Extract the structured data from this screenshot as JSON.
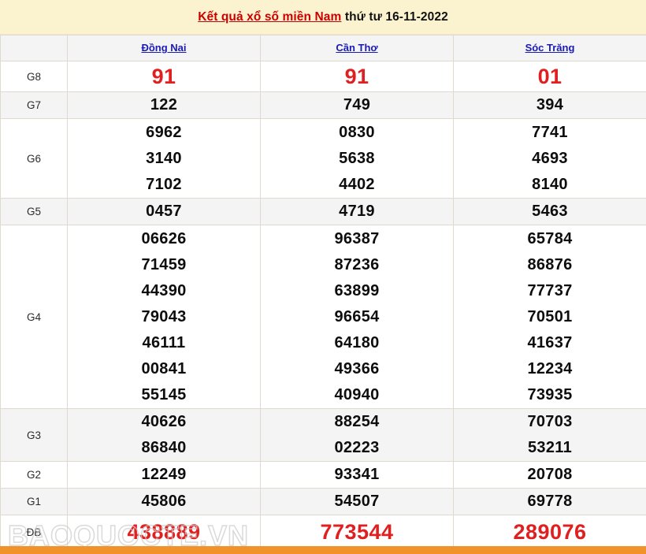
{
  "header": {
    "title_highlight": "Kết quả xổ số miền Nam",
    "title_rest": " thứ tư 16-11-2022"
  },
  "table": {
    "corner_label": "",
    "columns": [
      "Đồng Nai",
      "Cần Thơ",
      "Sóc Trăng"
    ],
    "rows": [
      {
        "label": "G8",
        "style": "special",
        "cells": [
          [
            "91"
          ],
          [
            "91"
          ],
          [
            "01"
          ]
        ]
      },
      {
        "label": "G7",
        "style": "normal",
        "cells": [
          [
            "122"
          ],
          [
            "749"
          ],
          [
            "394"
          ]
        ]
      },
      {
        "label": "G6",
        "style": "normal",
        "cells": [
          [
            "6962",
            "3140",
            "7102"
          ],
          [
            "0830",
            "5638",
            "4402"
          ],
          [
            "7741",
            "4693",
            "8140"
          ]
        ]
      },
      {
        "label": "G5",
        "style": "normal",
        "cells": [
          [
            "0457"
          ],
          [
            "4719"
          ],
          [
            "5463"
          ]
        ]
      },
      {
        "label": "G4",
        "style": "normal",
        "cells": [
          [
            "06626",
            "71459",
            "44390",
            "79043",
            "46111",
            "00841",
            "55145"
          ],
          [
            "96387",
            "87236",
            "63899",
            "96654",
            "64180",
            "49366",
            "40940"
          ],
          [
            "65784",
            "86876",
            "77737",
            "70501",
            "41637",
            "12234",
            "73935"
          ]
        ]
      },
      {
        "label": "G3",
        "style": "normal",
        "cells": [
          [
            "40626",
            "86840"
          ],
          [
            "88254",
            "02223"
          ],
          [
            "70703",
            "53211"
          ]
        ]
      },
      {
        "label": "G2",
        "style": "normal",
        "cells": [
          [
            "12249"
          ],
          [
            "93341"
          ],
          [
            "20708"
          ]
        ]
      },
      {
        "label": "G1",
        "style": "normal",
        "cells": [
          [
            "45806"
          ],
          [
            "54507"
          ],
          [
            "69778"
          ]
        ]
      },
      {
        "label": "ĐB",
        "style": "db",
        "cells": [
          [
            "438889"
          ],
          [
            "773544"
          ],
          [
            "289076"
          ]
        ]
      }
    ]
  },
  "watermark": {
    "text": "BAOQUOCTE.VN"
  },
  "colors": {
    "banner_bg": "#fbf3cf",
    "title_red": "#cc0000",
    "province_link": "#1a1ab5",
    "number_red": "#e02020",
    "row_alt_bg": "#f4f4f4",
    "bottom_bar": "#f0932b",
    "border": "#dedad0"
  }
}
